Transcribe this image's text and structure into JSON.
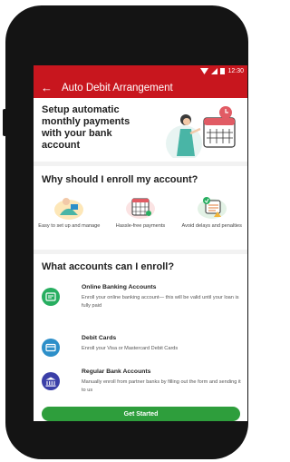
{
  "status": {
    "time": "12:30"
  },
  "appbar": {
    "title": "Auto Debit Arrangement"
  },
  "hero": {
    "text": "Setup automatic monthly payments with your bank account"
  },
  "why": {
    "title": "Why should I enroll my account?",
    "items": [
      {
        "label": "Easy to set up and manage",
        "icon": "person-relax-icon"
      },
      {
        "label": "Hassle-free payments",
        "icon": "calendar-icon"
      },
      {
        "label": "Avoid delays and penalties",
        "icon": "calendar-check-icon"
      }
    ]
  },
  "accounts": {
    "title": "What accounts can I enroll?",
    "items": [
      {
        "name": "Online Banking Accounts",
        "desc": "Enroll your online banking account— this will be valid until your loan is fully paid",
        "icon": "online-banking-icon",
        "color": "#27ae60"
      },
      {
        "name": "Debit Cards",
        "desc": "Enroll your Visa or Mastercard Debit Cards",
        "icon": "debit-card-icon",
        "color": "#2d8fc9"
      },
      {
        "name": "Regular Bank Accounts",
        "desc": "Manually enroll from partner banks by filling out the form and sending it to us",
        "icon": "bank-icon",
        "color": "#3b3fa8"
      }
    ]
  },
  "cta": {
    "label": "Get Started"
  },
  "colors": {
    "primary": "#c8161e",
    "cta": "#2e9e3c"
  }
}
